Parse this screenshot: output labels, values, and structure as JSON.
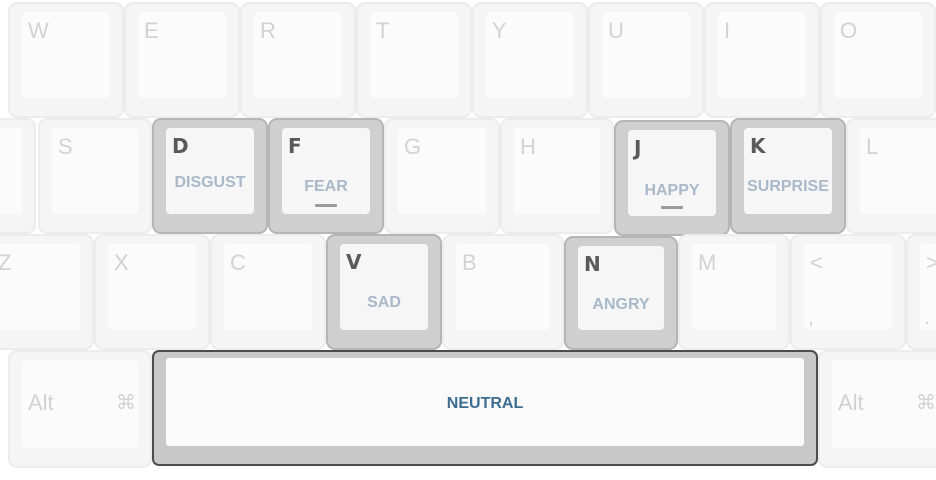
{
  "row_top": [
    {
      "id": "w",
      "letter": "W"
    },
    {
      "id": "e",
      "letter": "E"
    },
    {
      "id": "r",
      "letter": "R"
    },
    {
      "id": "t",
      "letter": "T"
    },
    {
      "id": "y",
      "letter": "Y"
    },
    {
      "id": "u",
      "letter": "U"
    },
    {
      "id": "i",
      "letter": "I"
    },
    {
      "id": "o",
      "letter": "O"
    }
  ],
  "row_home": [
    {
      "id": "s",
      "letter": "S"
    },
    {
      "id": "d",
      "letter": "D",
      "emotion": "DISGUST"
    },
    {
      "id": "f",
      "letter": "F",
      "emotion": "FEAR"
    },
    {
      "id": "g",
      "letter": "G"
    },
    {
      "id": "h",
      "letter": "H"
    },
    {
      "id": "j",
      "letter": "J",
      "emotion": "HAPPY"
    },
    {
      "id": "k",
      "letter": "K",
      "emotion": "SURPRISE"
    },
    {
      "id": "l",
      "letter": "L"
    }
  ],
  "row_bottom": [
    {
      "id": "z",
      "letter": "Z"
    },
    {
      "id": "x",
      "letter": "X"
    },
    {
      "id": "c",
      "letter": "C"
    },
    {
      "id": "v",
      "letter": "V",
      "emotion": "SAD"
    },
    {
      "id": "b",
      "letter": "B"
    },
    {
      "id": "n",
      "letter": "N",
      "emotion": "ANGRY"
    },
    {
      "id": "m",
      "letter": "M"
    },
    {
      "id": "comma",
      "letter": "<",
      "sub": ","
    },
    {
      "id": "period",
      "letter": ">",
      "sub": "."
    }
  ],
  "row_space": {
    "alt_left": {
      "label": "Alt",
      "glyph": "⌘"
    },
    "space": {
      "emotion": "NEUTRAL"
    },
    "alt_right": {
      "label": "Alt",
      "glyph": "⌘"
    }
  }
}
